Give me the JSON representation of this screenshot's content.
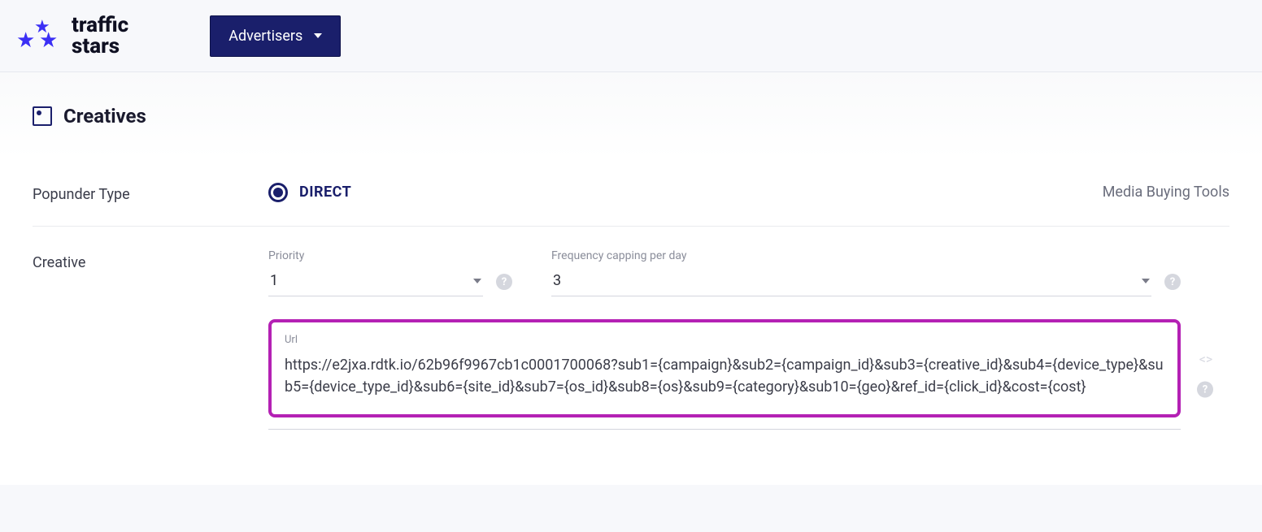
{
  "logo": {
    "line1": "traffic",
    "line2": "stars"
  },
  "nav": {
    "dropdown_label": "Advertisers"
  },
  "section": {
    "title": "Creatives"
  },
  "form": {
    "popunder_type_label": "Popunder Type",
    "popunder_type_value": "DIRECT",
    "media_tools_label": "Media Buying Tools",
    "creative_label": "Creative",
    "priority_label": "Priority",
    "priority_value": "1",
    "freq_label": "Frequency capping per day",
    "freq_value": "3",
    "url_label": "Url",
    "url_value": "https://e2jxa.rdtk.io/62b96f9967cb1c0001700068?sub1={campaign}&sub2={campaign_id}&sub3={creative_id}&sub4={device_type}&sub5={device_type_id}&sub6={site_id}&sub7={os_id}&sub8={os}&sub9={category}&sub10={geo}&ref_id={click_id}&cost={cost}"
  }
}
